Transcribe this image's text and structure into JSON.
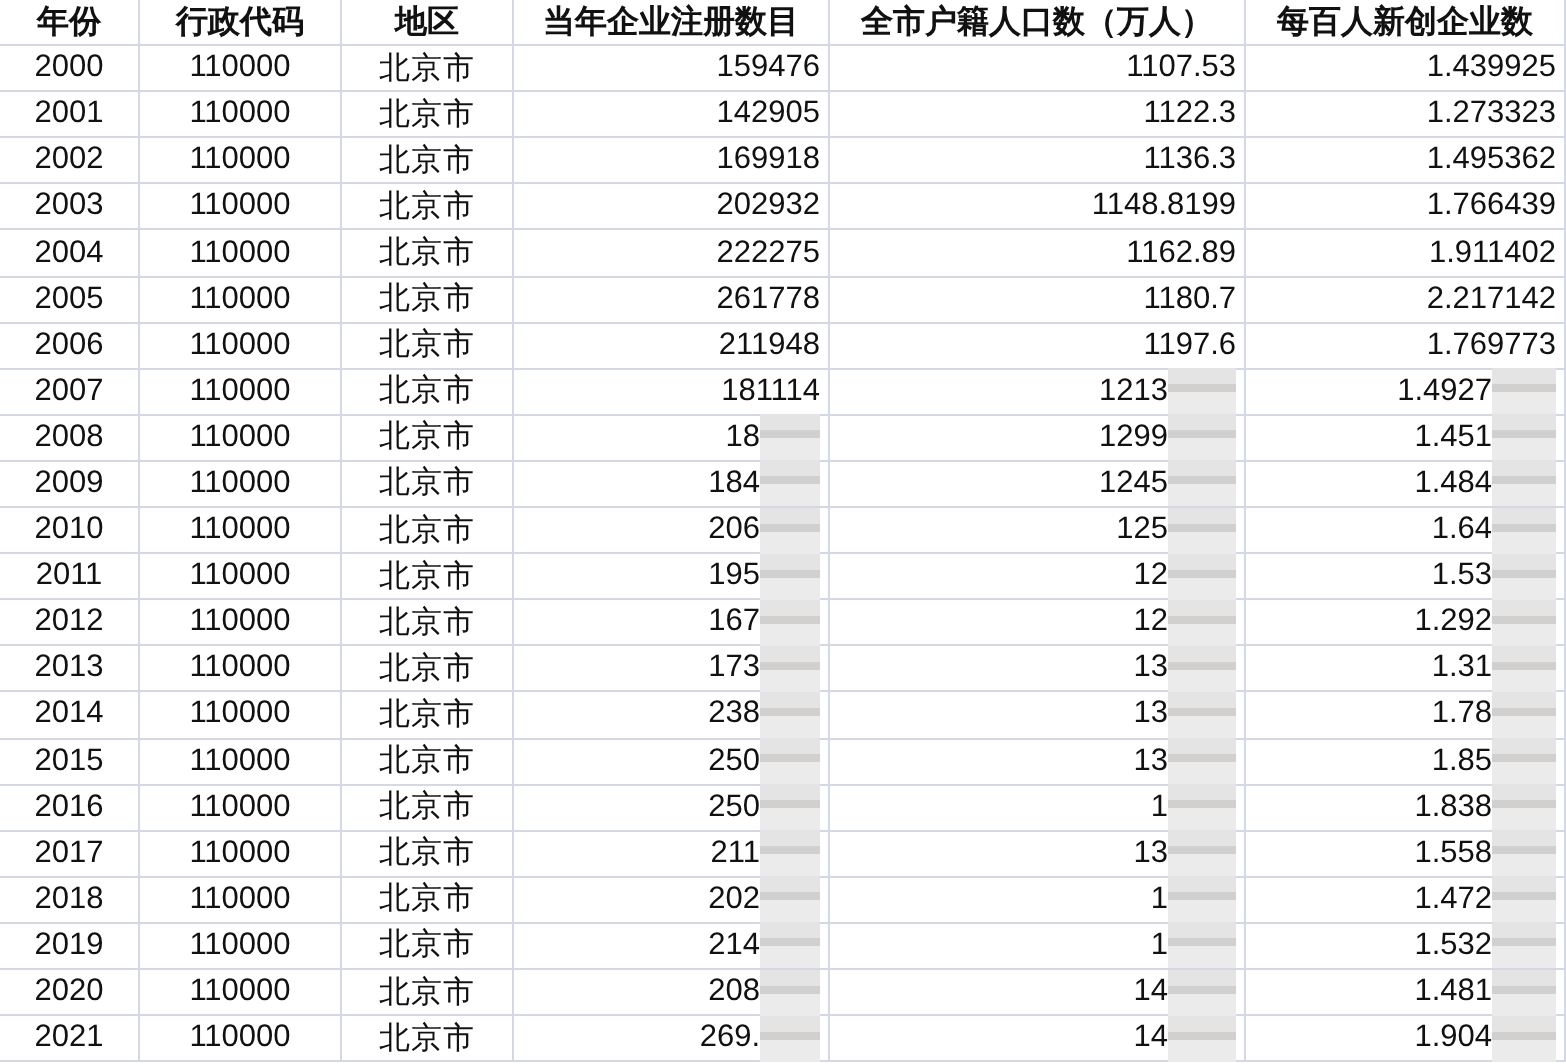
{
  "table": {
    "columns": [
      "年份",
      "行政代码",
      "地区",
      "当年企业注册数目",
      "全市户籍人口数（万人）",
      "每百人新创企业数"
    ],
    "rows": [
      {
        "cells": [
          {
            "text": "2000",
            "redacted": false
          },
          {
            "text": "110000",
            "redacted": false
          },
          {
            "text": "北京市",
            "redacted": false
          },
          {
            "text": "159476",
            "redacted": false
          },
          {
            "text": "1107.53",
            "redacted": false
          },
          {
            "text": "1.439925",
            "redacted": false
          }
        ]
      },
      {
        "cells": [
          {
            "text": "2001",
            "redacted": false
          },
          {
            "text": "110000",
            "redacted": false
          },
          {
            "text": "北京市",
            "redacted": false
          },
          {
            "text": "142905",
            "redacted": false
          },
          {
            "text": "1122.3",
            "redacted": false
          },
          {
            "text": "1.273323",
            "redacted": false
          }
        ]
      },
      {
        "cells": [
          {
            "text": "2002",
            "redacted": false
          },
          {
            "text": "110000",
            "redacted": false
          },
          {
            "text": "北京市",
            "redacted": false
          },
          {
            "text": "169918",
            "redacted": false
          },
          {
            "text": "1136.3",
            "redacted": false
          },
          {
            "text": "1.495362",
            "redacted": false
          }
        ]
      },
      {
        "cells": [
          {
            "text": "2003",
            "redacted": false
          },
          {
            "text": "110000",
            "redacted": false
          },
          {
            "text": "北京市",
            "redacted": false
          },
          {
            "text": "202932",
            "redacted": false
          },
          {
            "text": "1148.8199",
            "redacted": false
          },
          {
            "text": "1.766439",
            "redacted": false
          }
        ]
      },
      {
        "cells": [
          {
            "text": "2004",
            "redacted": false
          },
          {
            "text": "110000",
            "redacted": false
          },
          {
            "text": "北京市",
            "redacted": false
          },
          {
            "text": "222275",
            "redacted": false
          },
          {
            "text": "1162.89",
            "redacted": false
          },
          {
            "text": "1.911402",
            "redacted": false
          }
        ]
      },
      {
        "cells": [
          {
            "text": "2005",
            "redacted": false
          },
          {
            "text": "110000",
            "redacted": false
          },
          {
            "text": "北京市",
            "redacted": false
          },
          {
            "text": "261778",
            "redacted": false
          },
          {
            "text": "1180.7",
            "redacted": false
          },
          {
            "text": "2.217142",
            "redacted": false
          }
        ]
      },
      {
        "cells": [
          {
            "text": "2006",
            "redacted": false
          },
          {
            "text": "110000",
            "redacted": false
          },
          {
            "text": "北京市",
            "redacted": false
          },
          {
            "text": "211948",
            "redacted": false
          },
          {
            "text": "1197.6",
            "redacted": false
          },
          {
            "text": "1.769773",
            "redacted": false
          }
        ]
      },
      {
        "cells": [
          {
            "text": "2007",
            "redacted": false
          },
          {
            "text": "110000",
            "redacted": false
          },
          {
            "text": "北京市",
            "redacted": false
          },
          {
            "text": "181114",
            "redacted": false
          },
          {
            "text": "1213",
            "redacted": true
          },
          {
            "text": "1.4927",
            "redacted": true
          }
        ]
      },
      {
        "cells": [
          {
            "text": "2008",
            "redacted": false
          },
          {
            "text": "110000",
            "redacted": false
          },
          {
            "text": "北京市",
            "redacted": false
          },
          {
            "text": "18",
            "redacted": true
          },
          {
            "text": "1299",
            "redacted": true
          },
          {
            "text": "1.451",
            "redacted": true
          }
        ]
      },
      {
        "cells": [
          {
            "text": "2009",
            "redacted": false
          },
          {
            "text": "110000",
            "redacted": false
          },
          {
            "text": "北京市",
            "redacted": false
          },
          {
            "text": "184",
            "redacted": true
          },
          {
            "text": "1245",
            "redacted": true
          },
          {
            "text": "1.484",
            "redacted": true
          }
        ]
      },
      {
        "cells": [
          {
            "text": "2010",
            "redacted": false
          },
          {
            "text": "110000",
            "redacted": false
          },
          {
            "text": "北京市",
            "redacted": false
          },
          {
            "text": "206",
            "redacted": true
          },
          {
            "text": "125",
            "redacted": true
          },
          {
            "text": "1.64",
            "redacted": true
          }
        ]
      },
      {
        "cells": [
          {
            "text": "2011",
            "redacted": false
          },
          {
            "text": "110000",
            "redacted": false
          },
          {
            "text": "北京市",
            "redacted": false
          },
          {
            "text": "195",
            "redacted": true
          },
          {
            "text": "12",
            "redacted": true
          },
          {
            "text": "1.53",
            "redacted": true
          }
        ]
      },
      {
        "cells": [
          {
            "text": "2012",
            "redacted": false
          },
          {
            "text": "110000",
            "redacted": false
          },
          {
            "text": "北京市",
            "redacted": false
          },
          {
            "text": "167",
            "redacted": true
          },
          {
            "text": "12",
            "redacted": true
          },
          {
            "text": "1.292",
            "redacted": true
          }
        ]
      },
      {
        "cells": [
          {
            "text": "2013",
            "redacted": false
          },
          {
            "text": "110000",
            "redacted": false
          },
          {
            "text": "北京市",
            "redacted": false
          },
          {
            "text": "173",
            "redacted": true
          },
          {
            "text": "13",
            "redacted": true
          },
          {
            "text": "1.31",
            "redacted": true
          }
        ]
      },
      {
        "cells": [
          {
            "text": "2014",
            "redacted": false
          },
          {
            "text": "110000",
            "redacted": false
          },
          {
            "text": "北京市",
            "redacted": false
          },
          {
            "text": "238",
            "redacted": true
          },
          {
            "text": "13",
            "redacted": true
          },
          {
            "text": "1.78",
            "redacted": true
          }
        ]
      },
      {
        "cells": [
          {
            "text": "2015",
            "redacted": false
          },
          {
            "text": "110000",
            "redacted": false
          },
          {
            "text": "北京市",
            "redacted": false
          },
          {
            "text": "250",
            "redacted": true
          },
          {
            "text": "13",
            "redacted": true
          },
          {
            "text": "1.85",
            "redacted": true
          }
        ]
      },
      {
        "cells": [
          {
            "text": "2016",
            "redacted": false
          },
          {
            "text": "110000",
            "redacted": false
          },
          {
            "text": "北京市",
            "redacted": false
          },
          {
            "text": "250",
            "redacted": true
          },
          {
            "text": "1",
            "redacted": true
          },
          {
            "text": "1.838",
            "redacted": true
          }
        ]
      },
      {
        "cells": [
          {
            "text": "2017",
            "redacted": false
          },
          {
            "text": "110000",
            "redacted": false
          },
          {
            "text": "北京市",
            "redacted": false
          },
          {
            "text": "211",
            "redacted": true
          },
          {
            "text": "13",
            "redacted": true
          },
          {
            "text": "1.558",
            "redacted": true
          }
        ]
      },
      {
        "cells": [
          {
            "text": "2018",
            "redacted": false
          },
          {
            "text": "110000",
            "redacted": false
          },
          {
            "text": "北京市",
            "redacted": false
          },
          {
            "text": "202",
            "redacted": true
          },
          {
            "text": "1",
            "redacted": true
          },
          {
            "text": "1.472",
            "redacted": true
          }
        ]
      },
      {
        "cells": [
          {
            "text": "2019",
            "redacted": false
          },
          {
            "text": "110000",
            "redacted": false
          },
          {
            "text": "北京市",
            "redacted": false
          },
          {
            "text": "214",
            "redacted": true
          },
          {
            "text": "1",
            "redacted": true
          },
          {
            "text": "1.532",
            "redacted": true
          }
        ]
      },
      {
        "cells": [
          {
            "text": "2020",
            "redacted": false
          },
          {
            "text": "110000",
            "redacted": false
          },
          {
            "text": "北京市",
            "redacted": false
          },
          {
            "text": "208",
            "redacted": true
          },
          {
            "text": "14",
            "redacted": true
          },
          {
            "text": "1.481",
            "redacted": true
          }
        ]
      },
      {
        "cells": [
          {
            "text": "2021",
            "redacted": false
          },
          {
            "text": "110000",
            "redacted": false
          },
          {
            "text": "北京市",
            "redacted": false
          },
          {
            "text": "269.",
            "redacted": true
          },
          {
            "text": "14",
            "redacted": true
          },
          {
            "text": "1.904",
            "redacted": true
          }
        ]
      }
    ]
  }
}
